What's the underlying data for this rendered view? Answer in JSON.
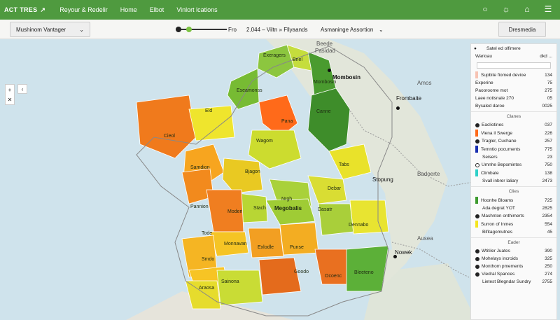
{
  "topbar": {
    "brand": "ACT TRES",
    "nav": [
      "Reyour & Redelir",
      "Home",
      "Elbot",
      "Vinlort lcations"
    ],
    "icons": [
      "pin-icon",
      "compass-icon",
      "home-icon",
      "menu-icon"
    ]
  },
  "toolbar": {
    "left_dropdown": "Mushinom Vantager",
    "slider_a": "Fro",
    "slider_readout": "2.044 – Viltn » Fllyaands",
    "menu_1": "Asmaninge",
    "menu_2": "Assortion",
    "right_button": "Dresmedia"
  },
  "map": {
    "regions": [
      {
        "name": "Exeragers",
        "color": "#8cc63f",
        "label": "Exeragers"
      },
      {
        "name": "Bnel",
        "color": "#c5dd3d",
        "label": "Bnel"
      },
      {
        "name": "Mombosin",
        "color": "#4a9b2f",
        "label": "Mombosin"
      },
      {
        "name": "Canne",
        "color": "#3e8d2a",
        "label": "Canne"
      },
      {
        "name": "Pana",
        "color": "#ff6a1a",
        "label": "Pana"
      },
      {
        "name": "Eseamonss",
        "color": "#77bb33",
        "label": "Eseamonss"
      },
      {
        "name": "Cieol",
        "color": "#f07a1c",
        "label": "Cieol"
      },
      {
        "name": "Samdion",
        "color": "#f7a51f",
        "label": "Samdion"
      },
      {
        "name": "Pannion",
        "color": "#f28a1d",
        "label": "Pannion"
      },
      {
        "name": "Wagom",
        "color": "#ccdc2f",
        "label": "Wagom"
      },
      {
        "name": "Tabs",
        "color": "#e9e22a",
        "label": "Tabs"
      },
      {
        "name": "Bjagon",
        "color": "#e9c922",
        "label": "Bjagon"
      },
      {
        "name": "Nrgh",
        "color": "#a9d13a",
        "label": "Nrgh"
      },
      {
        "name": "Debar",
        "color": "#d9dd33",
        "label": "Debar"
      },
      {
        "name": "Megobalis",
        "color": "#9fcc35",
        "label": "Megobalis"
      },
      {
        "name": "Stach",
        "color": "#b8d634",
        "label": "Stach"
      },
      {
        "name": "Moderi",
        "color": "#f07e20",
        "label": "Moderi"
      },
      {
        "name": "Monnavan",
        "color": "#f5c425",
        "label": "Monnavan"
      },
      {
        "name": "Exlodle",
        "color": "#f29f22",
        "label": "Exlodle"
      },
      {
        "name": "Punse",
        "color": "#f3ad22",
        "label": "Punse"
      },
      {
        "name": "Dasatr",
        "color": "#a9cf3a",
        "label": "Dasatr"
      },
      {
        "name": "Dennabo",
        "color": "#e8e431",
        "label": "Dennabo"
      },
      {
        "name": "Tode",
        "color": "#f5b523",
        "label": "Tode"
      },
      {
        "name": "Smdo",
        "color": "#f7c424",
        "label": "Smdo"
      },
      {
        "name": "Araosa",
        "color": "#e6dc2d",
        "label": "Araosa"
      },
      {
        "name": "Goodo",
        "color": "#e46b1c",
        "label": "Goodo"
      },
      {
        "name": "Sainona",
        "color": "#c9dc35",
        "label": "Sainona"
      },
      {
        "name": "Ocoenc",
        "color": "#e97020",
        "label": "Ocoenc"
      },
      {
        "name": "Bleeteno",
        "color": "#5cb038",
        "label": "Bleeteno"
      },
      {
        "name": "Eld",
        "color": "#efe52d",
        "label": "Eld"
      }
    ],
    "cities": [
      "Mombosin",
      "Frombaite",
      "Stopung",
      "Nowek"
    ],
    "geo_labels": [
      "Beede",
      "Pasidad",
      "Amos",
      "Badoerte",
      "Ausea"
    ]
  },
  "panel": {
    "header": "Satel ed olfimere",
    "sec0_rows": [
      {
        "name": "Warioau",
        "value": "dkd ..."
      },
      {
        "name": "Supbite fiomed devioe",
        "value": "134"
      },
      {
        "name": "Experine",
        "value": "75"
      },
      {
        "name": "Paooroome mot",
        "value": "275"
      },
      {
        "name": "Laee notisnale 270",
        "value": "05"
      },
      {
        "name": "Bysaled daroe",
        "value": "0025"
      }
    ],
    "sections": [
      {
        "title": "Clanes",
        "rows": [
          {
            "name": "Eacliotines",
            "value": "037",
            "color": "#222",
            "shape": "dot"
          },
          {
            "name": "Viena il Swerge",
            "value": "226",
            "color": "#ff6a1a",
            "shape": "bar"
          },
          {
            "name": "Tragler, Cuchane",
            "value": "257",
            "color": "#222",
            "shape": "dot"
          },
          {
            "name": "Temntio pocuments",
            "value": "775",
            "color": "#1a2fb0",
            "shape": "bar"
          },
          {
            "name": "Seisers",
            "value": "23",
            "color": "",
            "shape": "none"
          },
          {
            "name": "Umnhe Bepomintes",
            "value": "750",
            "color": "#fff",
            "shape": "dot"
          },
          {
            "name": "Climbate",
            "value": "138",
            "color": "#2fd0c8",
            "shape": "bar"
          },
          {
            "name": "Svall inbrer laliary",
            "value": "2473",
            "color": "",
            "shape": "none"
          }
        ]
      },
      {
        "title": "Clies",
        "rows": [
          {
            "name": "Hoonhe Bloams",
            "value": "725",
            "color": "#3e9b2f",
            "shape": "bar"
          },
          {
            "name": "Ada degrat YOT",
            "value": "2825",
            "color": "",
            "shape": "none"
          },
          {
            "name": "Mashnton onthimerts",
            "value": "2354",
            "color": "#222",
            "shape": "dot"
          },
          {
            "name": "Surron of Inmes",
            "value": "554",
            "color": "#f4e520",
            "shape": "bar"
          },
          {
            "name": "Bifitagomutnes",
            "value": "45",
            "color": "",
            "shape": "none"
          }
        ]
      },
      {
        "title": "Eader",
        "rows": [
          {
            "name": "Wtitiler Juates",
            "value": "390",
            "color": "#222",
            "shape": "dot"
          },
          {
            "name": "Mohelays incroids",
            "value": "325",
            "color": "#222",
            "shape": "dot"
          },
          {
            "name": "Monthom pmements",
            "value": "250",
            "color": "#222",
            "shape": "dot"
          },
          {
            "name": "Viedral Spances",
            "value": "274",
            "color": "#222",
            "shape": "dot"
          },
          {
            "name": "Lietest Blegndar Sundry",
            "value": "2755",
            "color": "",
            "shape": "none"
          }
        ]
      }
    ]
  }
}
